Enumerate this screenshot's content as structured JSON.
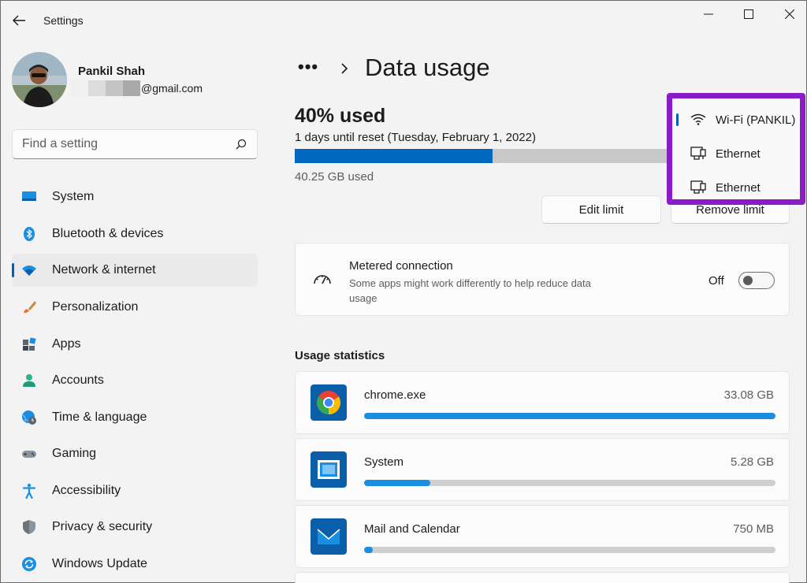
{
  "window": {
    "title": "Settings"
  },
  "profile": {
    "name": "Pankil Shah",
    "email_suffix": "@gmail.com"
  },
  "search": {
    "placeholder": "Find a setting"
  },
  "nav": {
    "items": [
      {
        "label": "System",
        "icon": "system-icon"
      },
      {
        "label": "Bluetooth & devices",
        "icon": "bluetooth-icon"
      },
      {
        "label": "Network & internet",
        "icon": "wifi-icon",
        "active": true
      },
      {
        "label": "Personalization",
        "icon": "brush-icon"
      },
      {
        "label": "Apps",
        "icon": "apps-icon"
      },
      {
        "label": "Accounts",
        "icon": "person-icon"
      },
      {
        "label": "Time & language",
        "icon": "globe-clock-icon"
      },
      {
        "label": "Gaming",
        "icon": "gamepad-icon"
      },
      {
        "label": "Accessibility",
        "icon": "accessibility-icon"
      },
      {
        "label": "Privacy & security",
        "icon": "shield-icon"
      },
      {
        "label": "Windows Update",
        "icon": "update-icon"
      }
    ]
  },
  "header": {
    "breadcrumb_more": "•••",
    "title": "Data usage"
  },
  "usage": {
    "percent_label": "40% used",
    "percent_used": 0.4,
    "reset_text": "1 days until reset (Tuesday, February 1, 2022)",
    "used_text": "40.25 GB used",
    "edit_limit": "Edit limit",
    "remove_limit": "Remove limit"
  },
  "network_menu": {
    "items": [
      {
        "label": "Wi-Fi (PANKIL)",
        "icon": "wifi-icon",
        "selected": true
      },
      {
        "label": "Ethernet",
        "icon": "ethernet-icon"
      },
      {
        "label": "Ethernet",
        "icon": "ethernet-icon"
      }
    ]
  },
  "metered": {
    "title": "Metered connection",
    "description": "Some apps might work differently to help reduce data usage",
    "state": "Off"
  },
  "stats": {
    "title": "Usage statistics",
    "apps": [
      {
        "name": "chrome.exe",
        "size": "33.08 GB",
        "fraction": 1.0,
        "icon": "chrome-icon"
      },
      {
        "name": "System",
        "size": "5.28 GB",
        "fraction": 0.16,
        "icon": "system-app-icon"
      },
      {
        "name": "Mail and Calendar",
        "size": "750 MB",
        "fraction": 0.022,
        "icon": "mail-icon"
      }
    ]
  },
  "colors": {
    "accent": "#0067c0",
    "highlight_border": "#8b1bc9",
    "bar_fill": "#1a8ee0"
  }
}
